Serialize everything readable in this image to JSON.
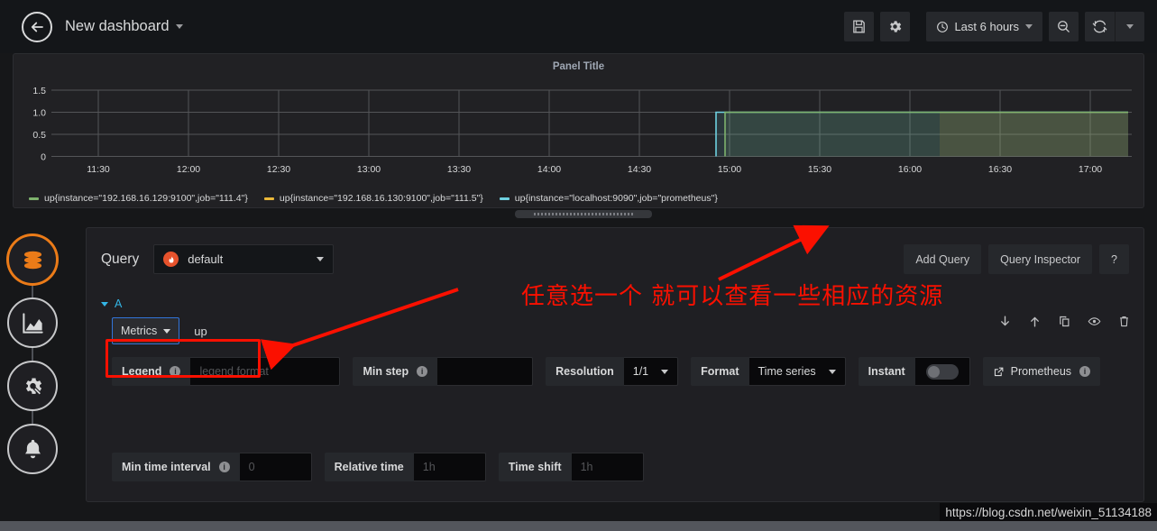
{
  "navbar": {
    "back_icon": "arrow-left-circle-icon",
    "title": "New dashboard",
    "save_icon": "save-floppy-icon",
    "settings_icon": "gear-icon",
    "time_range": "Last 6 hours",
    "clock_icon": "clock-icon",
    "zoom_out_icon": "zoom-out-magnifier-icon",
    "refresh_icon": "refresh-icon"
  },
  "panel": {
    "title": "Panel Title",
    "y_ticks": [
      "1.5",
      "1.0",
      "0.5",
      "0"
    ],
    "x_ticks": [
      "11:30",
      "12:00",
      "12:30",
      "13:00",
      "13:30",
      "14:00",
      "14:30",
      "15:00",
      "15:30",
      "16:00",
      "16:30",
      "17:00"
    ],
    "legend": [
      {
        "label": "up{instance=\"192.168.16.129:9100\",job=\"111.4\"}",
        "color": "#7eb26d"
      },
      {
        "label": "up{instance=\"192.168.16.130:9100\",job=\"111.5\"}",
        "color": "#eab839"
      },
      {
        "label": "up{instance=\"localhost:9090\",job=\"prometheus\"}",
        "color": "#6ed0e0"
      }
    ],
    "resize_handle": "panel-resize-handle"
  },
  "chart_data": {
    "type": "line",
    "title": "Panel Title",
    "xlabel": "",
    "ylabel": "",
    "ylim": [
      0,
      1.6
    ],
    "y_ticks": [
      0,
      0.5,
      1.0,
      1.5
    ],
    "x_ticks": [
      "11:30",
      "12:00",
      "12:30",
      "13:00",
      "13:30",
      "14:00",
      "14:30",
      "15:00",
      "15:30",
      "16:00",
      "16:30",
      "17:00"
    ],
    "grid": true,
    "legend_position": "bottom",
    "fill": true,
    "series": [
      {
        "name": "up{instance=\"localhost:9090\",job=\"prometheus\"}",
        "color": "#6ed0e0",
        "x": [
          "14:53",
          "17:20"
        ],
        "values": [
          1,
          1
        ]
      },
      {
        "name": "up{instance=\"192.168.16.129:9100\",job=\"111.4\"}",
        "color": "#7eb26d",
        "x": [
          "14:55",
          "17:20"
        ],
        "values": [
          1,
          1
        ]
      },
      {
        "name": "up{instance=\"192.168.16.130:9100\",job=\"111.5\"}",
        "color": "#eab839",
        "x": [
          "16:06",
          "17:20"
        ],
        "values": [
          1,
          1
        ]
      }
    ]
  },
  "sidebar": {
    "items": [
      {
        "name": "queries-tab",
        "icon": "database-stack-icon",
        "active": true
      },
      {
        "name": "visualization-tab",
        "icon": "area-chart-icon",
        "active": false
      },
      {
        "name": "general-tab",
        "icon": "gear-wrench-icon",
        "active": false
      },
      {
        "name": "alert-tab",
        "icon": "bell-icon",
        "active": false
      }
    ]
  },
  "query_editor": {
    "query_label": "Query",
    "datasource": "default",
    "datasource_icon": "prometheus-flame-icon",
    "add_query_label": "Add Query",
    "query_inspector_label": "Query Inspector",
    "help_label": "?",
    "row_letter": "A",
    "metrics_label": "Metrics",
    "expression": "up",
    "row_actions": [
      {
        "name": "move-down-icon"
      },
      {
        "name": "move-up-icon"
      },
      {
        "name": "duplicate-icon"
      },
      {
        "name": "toggle-visibility-eye-icon"
      },
      {
        "name": "delete-trash-icon"
      }
    ],
    "legend_label": "Legend",
    "legend_placeholder": "legend format",
    "legend_value": "",
    "min_step_label": "Min step",
    "min_step_value": "",
    "resolution_label": "Resolution",
    "resolution_value": "1/1",
    "format_label": "Format",
    "format_value": "Time series",
    "instant_label": "Instant",
    "instant_on": false,
    "prometheus_link_label": "Prometheus",
    "external_link_icon": "external-link-icon",
    "min_time_interval_label": "Min time interval",
    "min_time_interval_placeholder": "0",
    "relative_time_label": "Relative time",
    "relative_time_placeholder": "1h",
    "time_shift_label": "Time shift",
    "time_shift_placeholder": "1h"
  },
  "annotations": {
    "note_text": "任意选一个 就可以查看一些相应的资源",
    "note_color": "#fb1000",
    "highlight_box": "metrics-highlight-box",
    "arrow_to_panel": "arrow-pointing-to-graph",
    "arrow_to_metrics": "arrow-pointing-to-metrics"
  },
  "watermark": "https://blog.csdn.net/weixin_51134188"
}
